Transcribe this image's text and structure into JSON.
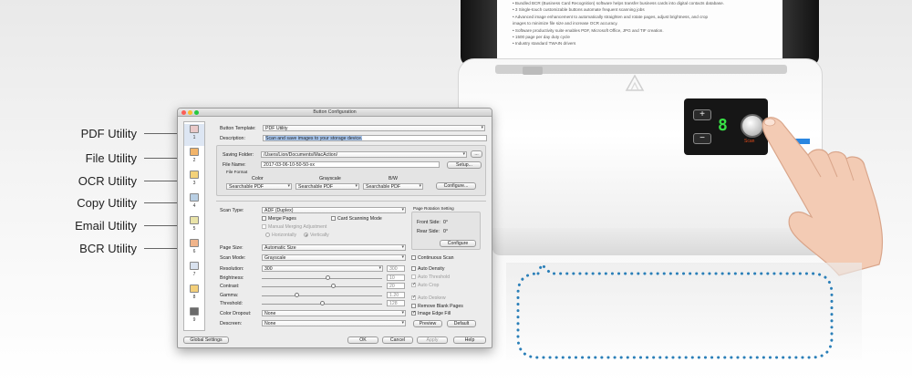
{
  "callouts": [
    "PDF Utility",
    "File Utility",
    "OCR Utility",
    "Copy Utility",
    "Email Utility",
    "BCR Utility"
  ],
  "paper_lines": [
    "• Bundled BCR (Business Card Recognition) software helps transfer business cards into digital contacts database.",
    "• 3 Single-touch customizable buttons automate frequent scanning jobs",
    "• Advanced image enhancement to automatically straighten and rotate pages, adjust brightness, and crop",
    "   images to minimize file size and increase OCR accuracy.",
    "• Software productivity suite enables PDF, Microsoft Office, JPG and TIF creation.",
    "• 1500 page per day duty cycle",
    "• Industry standard TWAIN drivers"
  ],
  "scanner": {
    "display_digit": "8",
    "scan_label": "Scan",
    "plus": "+",
    "minus": "−",
    "led_color": "#2a86e0",
    "digit_color": "#38e045"
  },
  "dialog": {
    "title": "Button Configuration",
    "button_list": [
      "1",
      "2",
      "3",
      "4",
      "5",
      "6",
      "7",
      "8",
      "9"
    ],
    "button_template_label": "Button Template:",
    "button_template_value": "PDF Utility",
    "description_label": "Description:",
    "description_value": "Scan and save images to your storage device.",
    "saving_folder_label": "Saving Folder:",
    "saving_folder_value": "/Users/Lion/Documents/MacAction/",
    "browse_label": "...",
    "file_name_label": "File Name:",
    "file_name_value": "2017-03-06-10-50-50-xx",
    "setup_label": "Setup...",
    "file_format_label": "File Format",
    "color_label": "Color",
    "grayscale_label": "Grayscale",
    "bw_label": "B/W",
    "color_format": "Searchable PDF",
    "grayscale_format": "Searchable PDF",
    "bw_format": "Searchable PDF",
    "configure_label": "Configure...",
    "scan_type_label": "Scan Type:",
    "scan_type_value": "ADF (Duplex)",
    "merge_pages": "Merge Pages",
    "card_scanning": "Card Scanning Mode",
    "manual_merging": "Manual Merging Adjustment",
    "horizontally": "Horizontally",
    "vertically": "Vertically",
    "page_rotation_label": "Page Rotation Setting",
    "front_side_label": "Front Side:",
    "front_side_value": "0°",
    "rear_side_label": "Rear Side:",
    "rear_side_value": "0°",
    "rotation_configure": "Configure",
    "page_size_label": "Page Size:",
    "page_size_value": "Automatic Size",
    "scan_mode_label": "Scan Mode:",
    "scan_mode_value": "Grayscale",
    "continuous_scan": "Continuous Scan",
    "resolution_label": "Resolution:",
    "resolution_value": "300",
    "resolution_box": "300",
    "brightness_label": "Brightness:",
    "brightness_value": "10",
    "contrast_label": "Contrast:",
    "contrast_value": "20",
    "gamma_label": "Gamma:",
    "gamma_value": "1.20",
    "threshold_label": "Threshold:",
    "threshold_value": "128",
    "color_dropout_label": "Color Dropout:",
    "color_dropout_value": "None",
    "descreen_label": "Descreen:",
    "descreen_value": "None",
    "auto_density": "Auto Density",
    "auto_threshold": "Auto Threshold",
    "auto_crop": "Auto Crop",
    "auto_deskew": "Auto Deskew",
    "remove_blank": "Remove Blank Pages",
    "image_edge_fill": "Image Edge Fill",
    "preview_label": "Preview",
    "default_label": "Default",
    "global_settings": "Global Settings",
    "ok": "OK",
    "cancel": "Cancel",
    "apply": "Apply",
    "help": "Help"
  },
  "colors": {
    "bubble_dots": "#2a7fb8",
    "selection": "#a8c7f0"
  }
}
